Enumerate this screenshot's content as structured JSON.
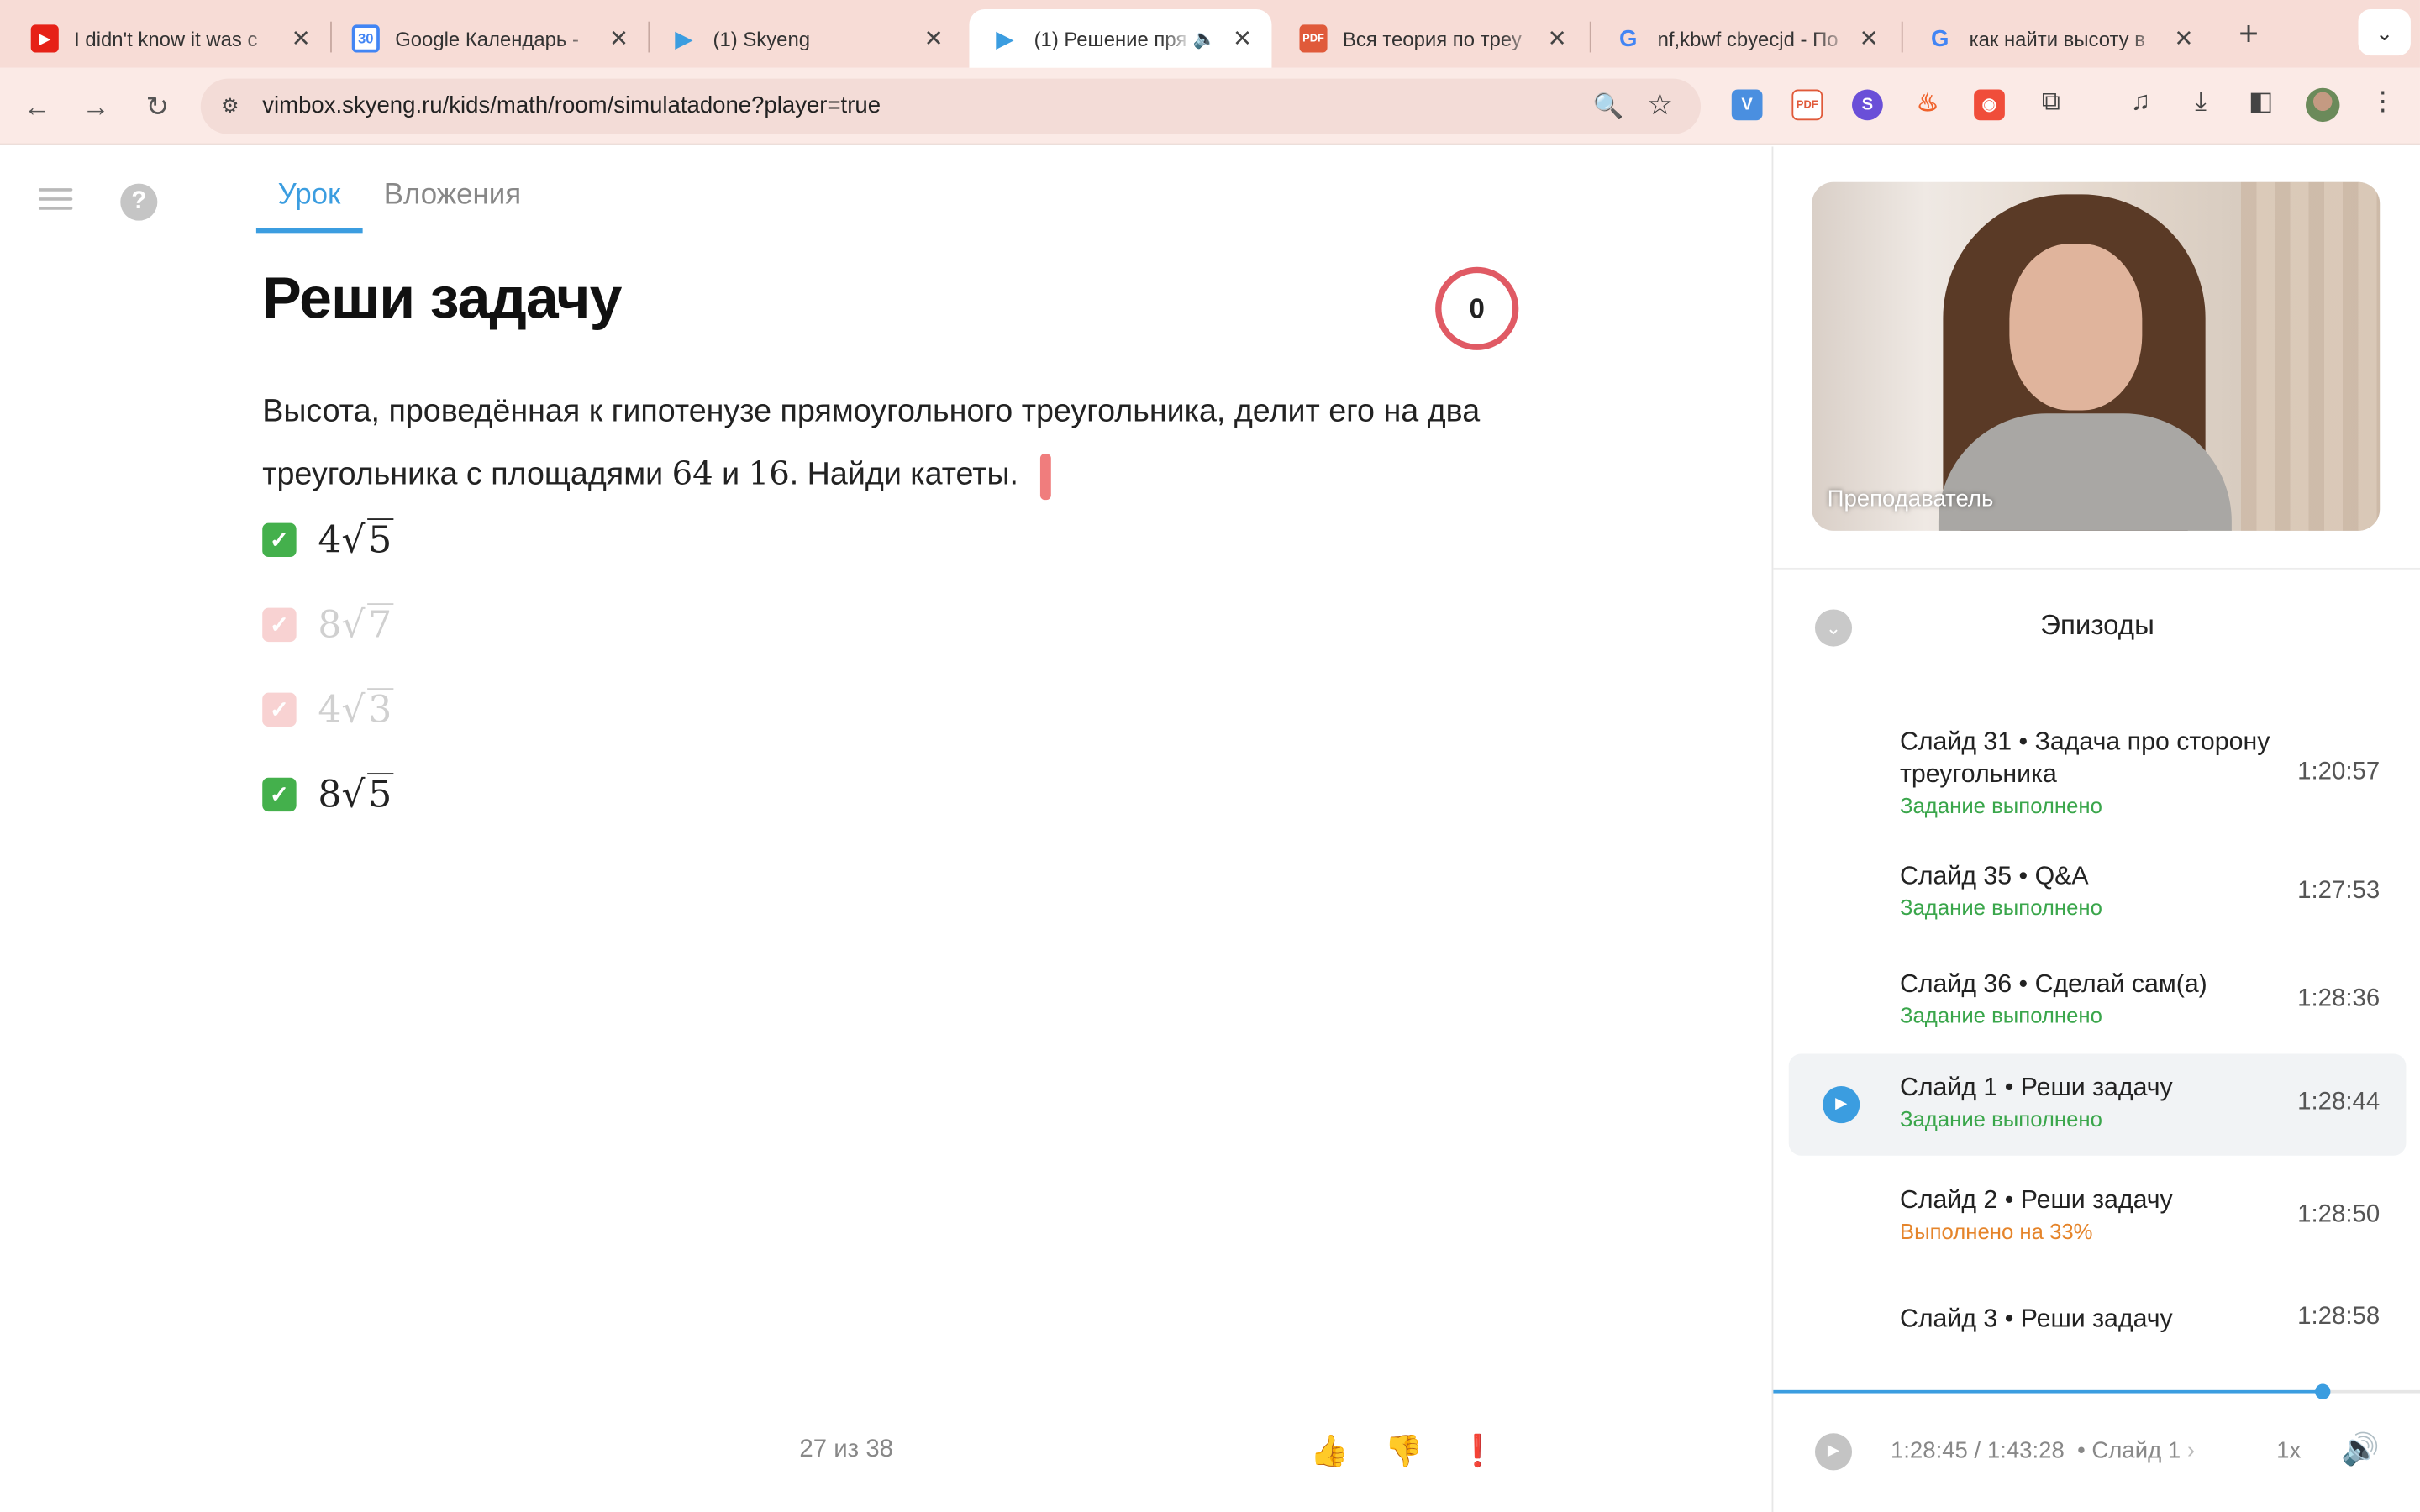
{
  "browser": {
    "tabs": [
      {
        "title": "I didn't know it was c",
        "icon": "youtube-icon",
        "color": "#e62117"
      },
      {
        "title": "Google Календарь -",
        "icon": "calendar-icon",
        "color": "#4285f4"
      },
      {
        "title": "(1) Skyeng",
        "icon": "skyeng-icon",
        "color": "#3b9de0"
      },
      {
        "title": "(1) Решение пря",
        "icon": "skyeng-icon",
        "color": "#3b9de0"
      },
      {
        "title": "Вся теория по треу",
        "icon": "pdf-icon",
        "color": "#e05a3a"
      },
      {
        "title": "nf,kbwf cbyecjd - По",
        "icon": "google-icon",
        "color": "#4285f4"
      },
      {
        "title": "как найти высоту в",
        "icon": "google-icon",
        "color": "#4285f4"
      }
    ],
    "active_tab": 3,
    "url": "vimbox.skyeng.ru/kids/math/room/simulatadone?player=true"
  },
  "lesson": {
    "tabs": [
      "Урок",
      "Вложения"
    ],
    "title": "Реши задачу",
    "score": "0",
    "task_part1": "Высота, проведённая к гипотенузе прямоугольного треугольника, делит его на два треугольника с площадями ",
    "task_num1": "64",
    "task_and": " и ",
    "task_num2": "16",
    "task_part2": ". Найди катеты.",
    "options": [
      {
        "coef": "4",
        "radicand": "5",
        "checked": true,
        "correct": true
      },
      {
        "coef": "8",
        "radicand": "7",
        "checked": false,
        "correct": false
      },
      {
        "coef": "4",
        "radicand": "3",
        "checked": false,
        "correct": false
      },
      {
        "coef": "8",
        "radicand": "5",
        "checked": true,
        "correct": true
      }
    ],
    "pager": "27 из 38"
  },
  "player": {
    "video_label": "Преподаватель",
    "episodes_title": "Эпизоды",
    "episodes": [
      {
        "name": "Слайд 31 • Задача про сторону треугольника",
        "status": "Задание выполнено",
        "status_type": "done",
        "time": "1:20:57"
      },
      {
        "name": "Слайд 35 • Q&A",
        "status": "Задание выполнено",
        "status_type": "done",
        "time": "1:27:53"
      },
      {
        "name": "Слайд 36 • Сделай сам(а)",
        "status": "Задание выполнено",
        "status_type": "done",
        "time": "1:28:36"
      },
      {
        "name": "Слайд 1 • Реши задачу",
        "status": "Задание выполнено",
        "status_type": "done",
        "time": "1:28:44",
        "active": true
      },
      {
        "name": "Слайд 2 • Реши задачу",
        "status": "Выполнено на 33%",
        "status_type": "partial",
        "time": "1:28:50"
      },
      {
        "name": "Слайд 3 • Реши задачу",
        "status": "",
        "status_type": "none",
        "time": "1:28:58"
      }
    ],
    "progress_fraction": 0.848,
    "time_display": "1:28:45 / 1:43:28",
    "current_slide": "• Слайд 1",
    "speed": "1x"
  },
  "colors": {
    "accent": "#3b9de0",
    "done": "#3aa64b",
    "partial": "#e5842a",
    "score_ring": "#e05a64"
  }
}
